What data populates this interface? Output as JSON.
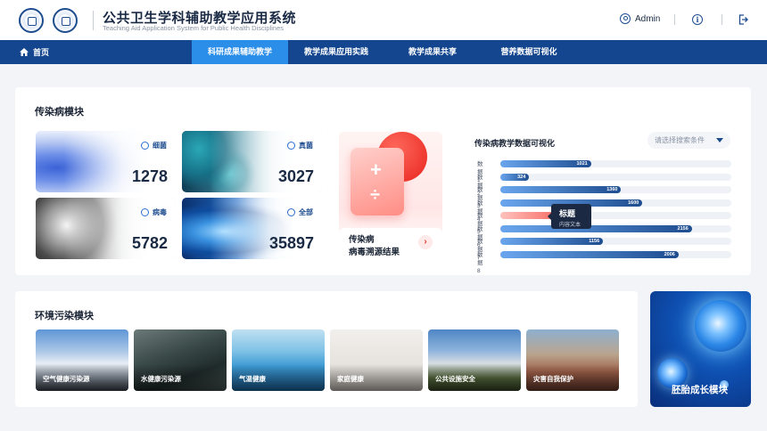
{
  "header": {
    "title": "公共卫生学科辅助教学应用系统",
    "subtitle": "Teaching Aid Application System for Public Health Disciplines",
    "user": "Admin"
  },
  "nav": {
    "home": "首页",
    "tabs": [
      {
        "label": "科研成果辅助教学",
        "active": true
      },
      {
        "label": "教学成果应用实践",
        "active": false
      },
      {
        "label": "教学成果共享",
        "active": false
      },
      {
        "label": "营养数据可视化",
        "active": false
      }
    ]
  },
  "infectious": {
    "title": "传染病模块",
    "tiles": [
      {
        "label": "细菌",
        "value": "1278",
        "icon": "bacteria-icon"
      },
      {
        "label": "真菌",
        "value": "3027",
        "icon": "fungus-icon"
      },
      {
        "label": "病毒",
        "value": "5782",
        "icon": "virus-icon"
      },
      {
        "label": "全部",
        "value": "35897",
        "icon": "all-icon"
      }
    ],
    "trace_card": {
      "line1": "传染病",
      "line2": "病毒溯源结果"
    },
    "viz": {
      "title": "传染病教学数据可视化",
      "select_placeholder": "请选择搜索条件",
      "tooltip_title": "标题",
      "tooltip_text": "内容文本"
    }
  },
  "chart_data": {
    "type": "bar",
    "orientation": "horizontal",
    "categories": [
      "数据1",
      "数据2",
      "数据3",
      "数据4",
      "数据5",
      "数据6",
      "数据7",
      "数据8"
    ],
    "values": [
      1021,
      324,
      1360,
      1600,
      974,
      2156,
      1156,
      2006
    ],
    "highlight_index": 4,
    "xlim": [
      0,
      2600
    ]
  },
  "environment": {
    "title": "环境污染模块",
    "tiles": [
      {
        "label": "空气健康污染源"
      },
      {
        "label": "水健康污染源"
      },
      {
        "label": "气温健康"
      },
      {
        "label": "家庭健康"
      },
      {
        "label": "公共设施安全"
      },
      {
        "label": "灾害自我保护"
      }
    ]
  },
  "embryo": {
    "label": "胚胎成长模块"
  },
  "colors": {
    "nav": "#14468f",
    "nav_active": "#2b8ee9",
    "accent_red": "#e8231d"
  }
}
